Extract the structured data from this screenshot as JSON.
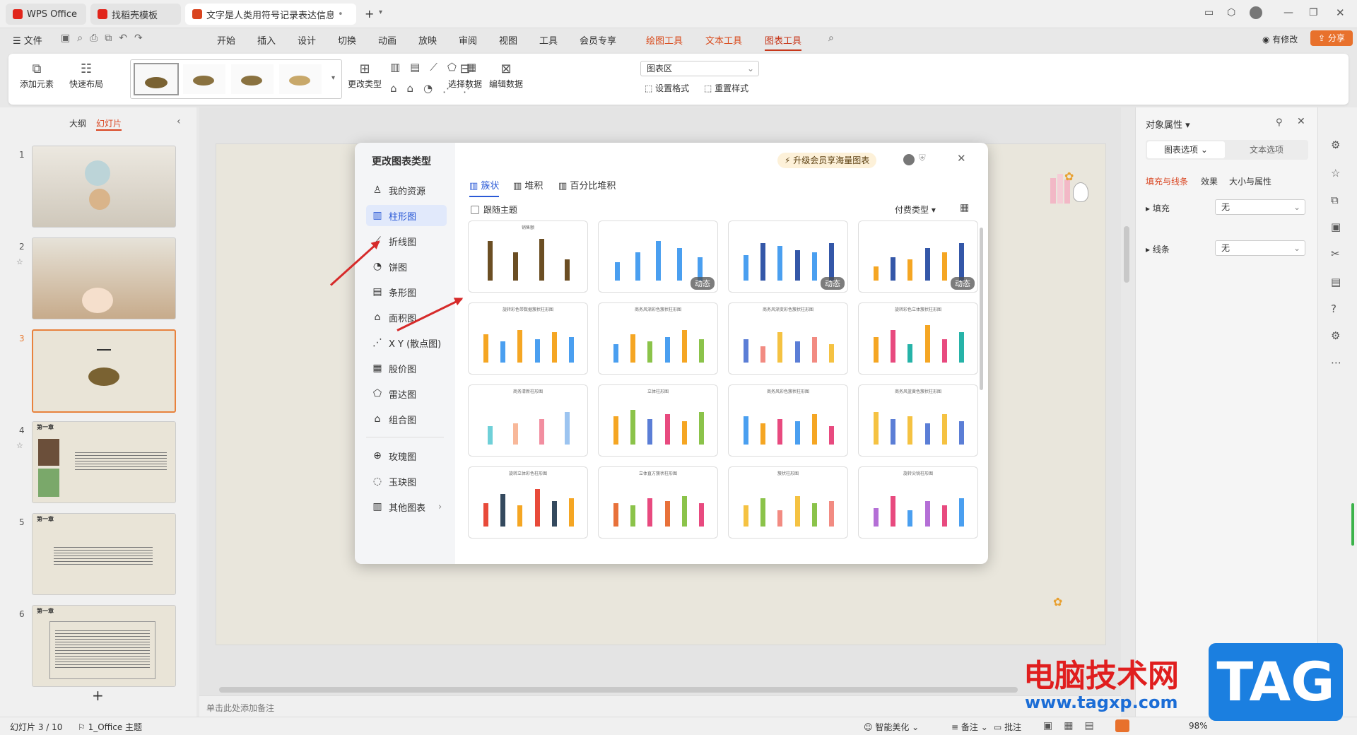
{
  "tabs": [
    {
      "label": "WPS Office"
    },
    {
      "label": "找稻壳模板"
    },
    {
      "label": "文字是人类用符号记录表达信息以"
    }
  ],
  "menu": {
    "file": "文件",
    "items": [
      "开始",
      "插入",
      "设计",
      "切换",
      "动画",
      "放映",
      "审阅",
      "视图",
      "工具",
      "会员专享",
      "绘图工具",
      "文本工具",
      "图表工具"
    ],
    "changes": "有修改",
    "share": "分享"
  },
  "ribbon": {
    "add_element": "添加元素",
    "quick_layout": "快速布局",
    "change_type": "更改类型",
    "select_data": "选择数据",
    "edit_data": "编辑数据",
    "chart_area": "图表区",
    "set_format": "设置格式",
    "reset_style": "重置样式"
  },
  "leftpane": {
    "outline": "大纲",
    "slides": "幻灯片",
    "thumbs": [
      {
        "n": "1"
      },
      {
        "n": "2"
      },
      {
        "n": "3"
      },
      {
        "n": "4"
      },
      {
        "n": "5"
      },
      {
        "n": "6"
      }
    ],
    "slide4_title": "第一章",
    "slide5_title": "第一章",
    "slide6_title": "第一章",
    "add": "+"
  },
  "dialog": {
    "title": "更改图表类型",
    "upgrade": "升级会员享海量图表",
    "nav": [
      "我的资源",
      "柱形图",
      "折线图",
      "饼图",
      "条形图",
      "面积图",
      "X Y (散点图)",
      "股价图",
      "雷达图",
      "组合图",
      "玫瑰图",
      "玉玦图",
      "其他图表"
    ],
    "subtabs": [
      "簇状",
      "堆积",
      "百分比堆积"
    ],
    "follow_theme": "跟随主题",
    "pay_type": "付费类型",
    "dynamic": "动态",
    "cards": [
      {
        "title": "销售额",
        "bars": [
          85,
          60,
          90,
          45
        ],
        "colors": [
          "#6b4e23"
        ]
      },
      {
        "title": "",
        "bars": [
          40,
          60,
          85,
          70,
          50
        ],
        "colors": [
          "#4a9ff0"
        ]
      },
      {
        "title": "",
        "bars": [
          55,
          80,
          75,
          65,
          60,
          80
        ],
        "colors": [
          "#4a9ff0",
          "#3457a8"
        ]
      },
      {
        "title": "",
        "bars": [
          30,
          50,
          45,
          70,
          60,
          80
        ],
        "colors": [
          "#f5a623",
          "#3457a8"
        ]
      },
      {
        "title": "旋转彩色带数据簇状柱形图",
        "bars": [
          60,
          45,
          70,
          50,
          65,
          55
        ],
        "colors": [
          "#f5a623",
          "#4a9ff0"
        ]
      },
      {
        "title": "商务风渐彩色簇状柱形图",
        "bars": [
          40,
          60,
          45,
          55,
          70,
          50
        ],
        "colors": [
          "#4a9ff0",
          "#f5a623",
          "#8bc34a"
        ]
      },
      {
        "title": "商务风渐变彩色簇状柱形图",
        "bars": [
          50,
          35,
          65,
          45,
          55,
          40
        ],
        "colors": [
          "#5b7ed6",
          "#f28b82",
          "#f5c242"
        ]
      },
      {
        "title": "旋转彩色立体簇状柱形图",
        "bars": [
          55,
          70,
          40,
          80,
          50,
          65
        ],
        "colors": [
          "#f5a623",
          "#e84a7f",
          "#26b3a8"
        ]
      },
      {
        "title": "商务清新柱形图",
        "bars": [
          40,
          45,
          55,
          70
        ],
        "colors": [
          "#6fd0d8",
          "#f8b89a",
          "#f28ea0",
          "#9cc4f0"
        ]
      },
      {
        "title": "立体柱形图",
        "bars": [
          60,
          75,
          55,
          65,
          50,
          70
        ],
        "colors": [
          "#f5a623",
          "#8bc34a",
          "#5b7ed6",
          "#e84a7f"
        ]
      },
      {
        "title": "商务风彩色簇状柱形图",
        "bars": [
          60,
          45,
          55,
          50,
          65,
          40
        ],
        "colors": [
          "#4a9ff0",
          "#f5a623",
          "#e84a7f"
        ]
      },
      {
        "title": "商务风蓝黄色簇状柱形图",
        "bars": [
          70,
          55,
          60,
          45,
          65,
          50
        ],
        "colors": [
          "#f5c242",
          "#5b7ed6"
        ]
      },
      {
        "title": "旋转立体彩色柱形图",
        "bars": [
          50,
          70,
          45,
          80,
          55,
          60
        ],
        "colors": [
          "#e84a3a",
          "#34495e",
          "#f5a623"
        ]
      },
      {
        "title": "立体直方簇状柱形图",
        "bars": [
          50,
          45,
          60,
          55,
          65,
          50
        ],
        "colors": [
          "#e8713a",
          "#8bc34a",
          "#e84a7f"
        ]
      },
      {
        "title": "簇状柱形图",
        "bars": [
          45,
          60,
          35,
          65,
          50,
          55
        ],
        "colors": [
          "#f5c242",
          "#8bc34a",
          "#f28b82"
        ]
      },
      {
        "title": "旋转尖锐柱形图",
        "bars": [
          40,
          65,
          35,
          55,
          45,
          60
        ],
        "colors": [
          "#b46fd6",
          "#e84a7f",
          "#4a9ff0"
        ]
      }
    ]
  },
  "rpanel": {
    "title": "对象属性",
    "tab1": "图表选项",
    "tab2": "文本选项",
    "sub1": "填充与线条",
    "sub2": "效果",
    "sub3": "大小与属性",
    "fill": "填充",
    "line": "线条",
    "none": "无"
  },
  "status": {
    "slide": "幻灯片 3 / 10",
    "theme": "1_Office 主题",
    "beautify": "智能美化",
    "notes": "备注",
    "comments": "批注",
    "zoom": "98%",
    "notes_placeholder": "单击此处添加备注"
  },
  "watermark": {
    "title": "电脑技术网",
    "url": "www.tagxp.com",
    "tag": "TAG"
  }
}
